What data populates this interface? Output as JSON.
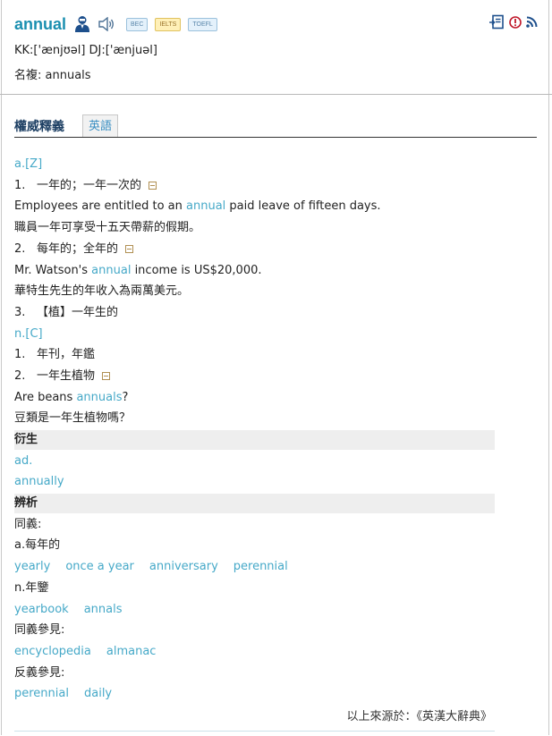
{
  "header": {
    "headword": "annual",
    "badges": [
      "BEC",
      "IELTS",
      "TOEFL"
    ],
    "pronunciation": "KK:['ænjʊəl] DJ:['ænjuəl]",
    "plural_label": "名複:",
    "plural_value": "annuals"
  },
  "tabs": {
    "main": "權威釋義",
    "english": "英語"
  },
  "entries": {
    "adj_pos": "a.[Z]",
    "sense1": {
      "num": "1.",
      "text": "一年的；一年一次的"
    },
    "ex1": {
      "pre": "Employees are entitled to an ",
      "kw": "annual",
      "post": " paid leave of fifteen days."
    },
    "tr1": "職員一年可享受十五天帶薪的假期。",
    "sense2": {
      "num": "2.",
      "text": "每年的；全年的"
    },
    "ex2": {
      "pre": "Mr. Watson's ",
      "kw": "annual",
      "post": " income is US$20,000."
    },
    "tr2": "華特生先生的年收入為兩萬美元。",
    "sense3": {
      "num": "3.",
      "text": "【植】一年生的"
    },
    "noun_pos": "n.[C]",
    "nsense1": {
      "num": "1.",
      "text": "年刊，年鑑"
    },
    "nsense2": {
      "num": "2.",
      "text": "一年生植物"
    },
    "ex3": {
      "pre": "Are beans ",
      "kw": "annuals",
      "post": "?"
    },
    "tr3": "豆類是一年生植物嗎？"
  },
  "derivation": {
    "title": "衍生",
    "pos": "ad.",
    "word": "annually"
  },
  "analysis": {
    "title": "辨析",
    "synonym_label": "同義:",
    "adj_label": "a.每年的",
    "adj_synonyms": [
      "yearly",
      "once a year",
      "anniversary",
      "perennial"
    ],
    "noun_label": "n.年鑒",
    "noun_synonyms": [
      "yearbook",
      "annals"
    ],
    "see_also_label": "同義參見:",
    "see_also": [
      "encyclopedia",
      "almanac"
    ],
    "antonym_label": "反義參見:",
    "antonyms": [
      "perennial",
      "daily"
    ]
  },
  "source": "以上來源於：《英漢大辭典》",
  "colors": {
    "headword": "#1a8fb0",
    "link": "#46a9c8",
    "tab_title": "#1d3f63",
    "section_bg": "#eeeeee"
  }
}
